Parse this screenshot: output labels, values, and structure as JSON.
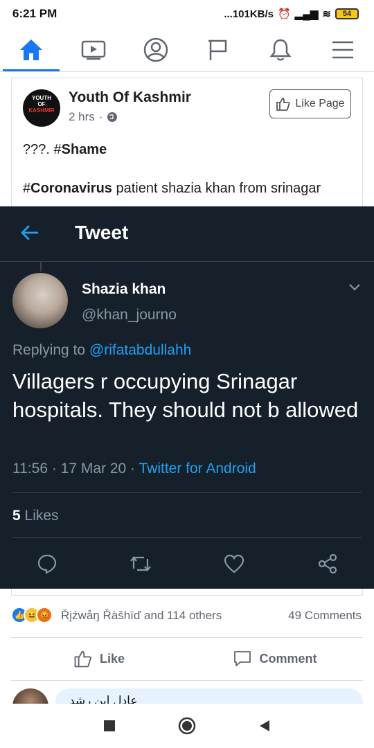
{
  "status_bar": {
    "time": "6:21 PM",
    "network_speed": "...101KB/s",
    "battery": "54"
  },
  "fb_nav": {
    "items": [
      "home-icon",
      "watch-icon",
      "profile-icon",
      "pages-flag-icon",
      "notifications-bell-icon",
      "menu-icon"
    ],
    "active_color": "#1877f2"
  },
  "post": {
    "page_name": "Youth Of Kashmir",
    "avatar_text_1": "YOUTH",
    "avatar_text_2": "OF",
    "avatar_text_3": "KASHMIR",
    "time": "2 hrs",
    "like_page_label": "Like Page",
    "line1_prefix": "???. #",
    "line1_bold": "Shame",
    "line2_hash": "#",
    "line2_bold": "Coronavirus",
    "line2_rest": " patient shazia khan from srinagar"
  },
  "tweet": {
    "header_title": "Tweet",
    "name": "Shazia khan",
    "handle": "@khan_journo",
    "replying_prefix": "Replying to ",
    "replying_to": "@rifatabdullahh",
    "text": "Villagers r occupying Srinagar hospitals. They should not b allowed",
    "timestamp": "11:56 · 17 Mar 20 · ",
    "source": "Twitter for Android",
    "likes_count": "5",
    "likes_label": " Likes",
    "colors": {
      "background": "#15202b",
      "accent": "#1da1f2",
      "muted": "#8899a6"
    }
  },
  "post_footer": {
    "reaction_text": "Řįźwåŋ Řàšhīď and 114 others",
    "comments_count": "49 Comments",
    "like_label": "Like",
    "comment_label": "Comment",
    "comment_preview": "عادل ابن رشد"
  }
}
